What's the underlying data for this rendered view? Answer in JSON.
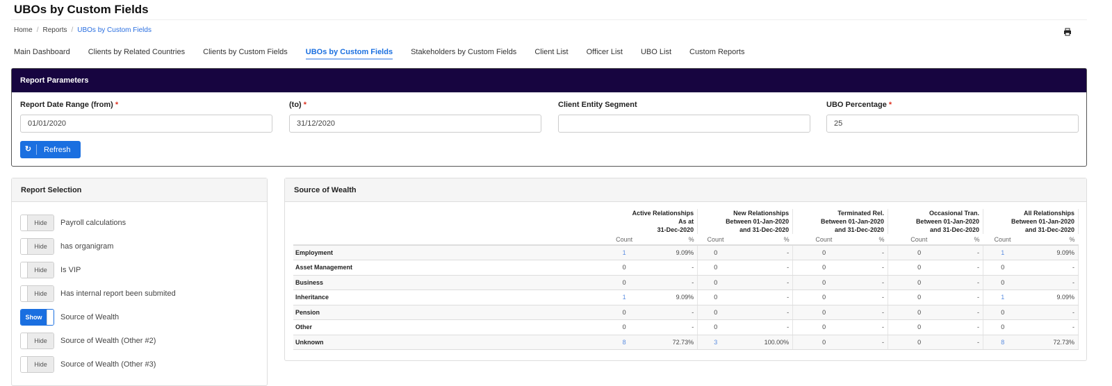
{
  "header": {
    "title": "UBOs by Custom Fields",
    "breadcrumb": [
      "Home",
      "Reports",
      "UBOs by Custom Fields"
    ]
  },
  "tabs": [
    "Main Dashboard",
    "Clients by Related Countries",
    "Clients by Custom Fields",
    "UBOs by Custom Fields",
    "Stakeholders by Custom Fields",
    "Client List",
    "Officer List",
    "UBO List",
    "Custom Reports"
  ],
  "active_tab": "UBOs by Custom Fields",
  "params": {
    "title": "Report Parameters",
    "fields": [
      {
        "label": "Report Date Range (from)",
        "required": "*",
        "value": "01/01/2020"
      },
      {
        "label": "(to)",
        "required": "*",
        "value": "31/12/2020"
      },
      {
        "label": "Client Entity Segment",
        "required": "",
        "value": ""
      },
      {
        "label": "UBO Percentage",
        "required": "*",
        "value": "25"
      }
    ],
    "refresh": "Refresh"
  },
  "selection": {
    "title": "Report Selection",
    "items": [
      {
        "state": "Hide",
        "label": "Payroll calculations"
      },
      {
        "state": "Hide",
        "label": "has organigram"
      },
      {
        "state": "Hide",
        "label": "Is VIP"
      },
      {
        "state": "Hide",
        "label": "Has internal report been submited"
      },
      {
        "state": "Show",
        "label": "Source of Wealth"
      },
      {
        "state": "Hide",
        "label": "Source of Wealth (Other #2)"
      },
      {
        "state": "Hide",
        "label": "Source of Wealth (Other #3)"
      }
    ]
  },
  "report": {
    "title": "Source of Wealth",
    "groups": [
      [
        "Active Relationships",
        "As at",
        "31-Dec-2020"
      ],
      [
        "New Relationships",
        "Between 01-Jan-2020",
        "and 31-Dec-2020"
      ],
      [
        "Terminated Rel.",
        "Between 01-Jan-2020",
        "and 31-Dec-2020"
      ],
      [
        "Occasional Tran.",
        "Between 01-Jan-2020",
        "and 31-Dec-2020"
      ],
      [
        "All Relationships",
        "Between 01-Jan-2020",
        "and 31-Dec-2020"
      ]
    ],
    "sub": [
      "Count",
      "%"
    ],
    "rows": [
      {
        "label": "Employment",
        "values": [
          [
            "1",
            "9.09%"
          ],
          [
            "0",
            "-"
          ],
          [
            "0",
            "-"
          ],
          [
            "0",
            "-"
          ],
          [
            "1",
            "9.09%"
          ]
        ]
      },
      {
        "label": "Asset Management",
        "values": [
          [
            "0",
            "-"
          ],
          [
            "0",
            "-"
          ],
          [
            "0",
            "-"
          ],
          [
            "0",
            "-"
          ],
          [
            "0",
            "-"
          ]
        ]
      },
      {
        "label": "Business",
        "values": [
          [
            "0",
            "-"
          ],
          [
            "0",
            "-"
          ],
          [
            "0",
            "-"
          ],
          [
            "0",
            "-"
          ],
          [
            "0",
            "-"
          ]
        ]
      },
      {
        "label": "Inheritance",
        "values": [
          [
            "1",
            "9.09%"
          ],
          [
            "0",
            "-"
          ],
          [
            "0",
            "-"
          ],
          [
            "0",
            "-"
          ],
          [
            "1",
            "9.09%"
          ]
        ]
      },
      {
        "label": "Pension",
        "values": [
          [
            "0",
            "-"
          ],
          [
            "0",
            "-"
          ],
          [
            "0",
            "-"
          ],
          [
            "0",
            "-"
          ],
          [
            "0",
            "-"
          ]
        ]
      },
      {
        "label": "Other",
        "values": [
          [
            "0",
            "-"
          ],
          [
            "0",
            "-"
          ],
          [
            "0",
            "-"
          ],
          [
            "0",
            "-"
          ],
          [
            "0",
            "-"
          ]
        ]
      },
      {
        "label": "Unknown",
        "values": [
          [
            "8",
            "72.73%"
          ],
          [
            "3",
            "100.00%"
          ],
          [
            "0",
            "-"
          ],
          [
            "0",
            "-"
          ],
          [
            "8",
            "72.73%"
          ]
        ]
      }
    ]
  },
  "colors": {
    "accent": "#1a6fe0",
    "header_dark": "#170540"
  }
}
